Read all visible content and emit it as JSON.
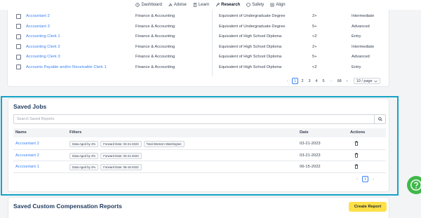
{
  "nav": {
    "items": [
      {
        "label": "Dashboard",
        "icon": "clock-icon"
      },
      {
        "label": "Advise",
        "icon": "advise-icon"
      },
      {
        "label": "Learn",
        "icon": "book-icon"
      },
      {
        "label": "Research",
        "icon": "research-icon",
        "active": true
      },
      {
        "label": "Safety",
        "icon": "shield-icon"
      },
      {
        "label": "Align",
        "icon": "align-icon"
      }
    ]
  },
  "jobs_table": {
    "rows": [
      {
        "title": "Accountant 2",
        "family": "Finance & Accounting",
        "education": "Equivalent of Undergraduate Degree",
        "experience": "2+",
        "level": "Intermediate"
      },
      {
        "title": "Accountant 3",
        "family": "Finance & Accounting",
        "education": "Equivalent of Undergraduate Degree",
        "experience": "5+",
        "level": "Advanced"
      },
      {
        "title": "Accounting Clerk 1",
        "family": "Finance & Accounting",
        "education": "Equivalent of High School Diploma",
        "experience": "<2",
        "level": "Entry"
      },
      {
        "title": "Accounting Clerk 2",
        "family": "Finance & Accounting",
        "education": "Equivalent of High School Diploma",
        "experience": "2+",
        "level": "Intermediate"
      },
      {
        "title": "Accounting Clerk 3",
        "family": "Finance & Accounting",
        "education": "Equivalent of High School Diploma",
        "experience": "5+",
        "level": "Advanced"
      },
      {
        "title": "Accounts Payable and/or Receivable Clerk 1",
        "family": "Finance & Accounting",
        "education": "Equivalent of High School Diploma",
        "experience": "<2",
        "level": "Entry"
      }
    ],
    "pagination": {
      "prev": "‹",
      "pages": [
        "1",
        "2",
        "3",
        "4",
        "5",
        "···",
        "68"
      ],
      "current": "1",
      "next": "›",
      "page_size": "10 / page"
    }
  },
  "saved_jobs": {
    "title": "Saved Jobs",
    "search_placeholder": "Search Saved Reports",
    "columns": {
      "name": "Name",
      "filters": "Filters",
      "date": "Date",
      "actions": "Actions"
    },
    "rows": [
      {
        "name": "Accountant 2",
        "filters": [
          "Data Aged by 4%",
          "Forward Date: 03-21-2023",
          "Total Western Washington"
        ],
        "date": "03-21-2023"
      },
      {
        "name": "Accountant 2",
        "filters": [
          "Data Aged by 4%",
          "Forward Date: 03-21-2023"
        ],
        "date": "03-21-2023"
      },
      {
        "name": "Accountant 1",
        "filters": [
          "Data Aged by 4%",
          "Forward Date: 06-15-2022"
        ],
        "date": "06-15-2022"
      }
    ],
    "pagination": {
      "prev": "‹",
      "current": "1",
      "next": "›"
    }
  },
  "custom_reports": {
    "title": "Saved Custom Compensation Reports",
    "create_label": "Create Report"
  },
  "colors": {
    "accent": "#3b82f6",
    "highlight": "#14a3c7",
    "create_button": "#fde047",
    "help": "#3fb84a",
    "heading": "#1e3a5f"
  }
}
